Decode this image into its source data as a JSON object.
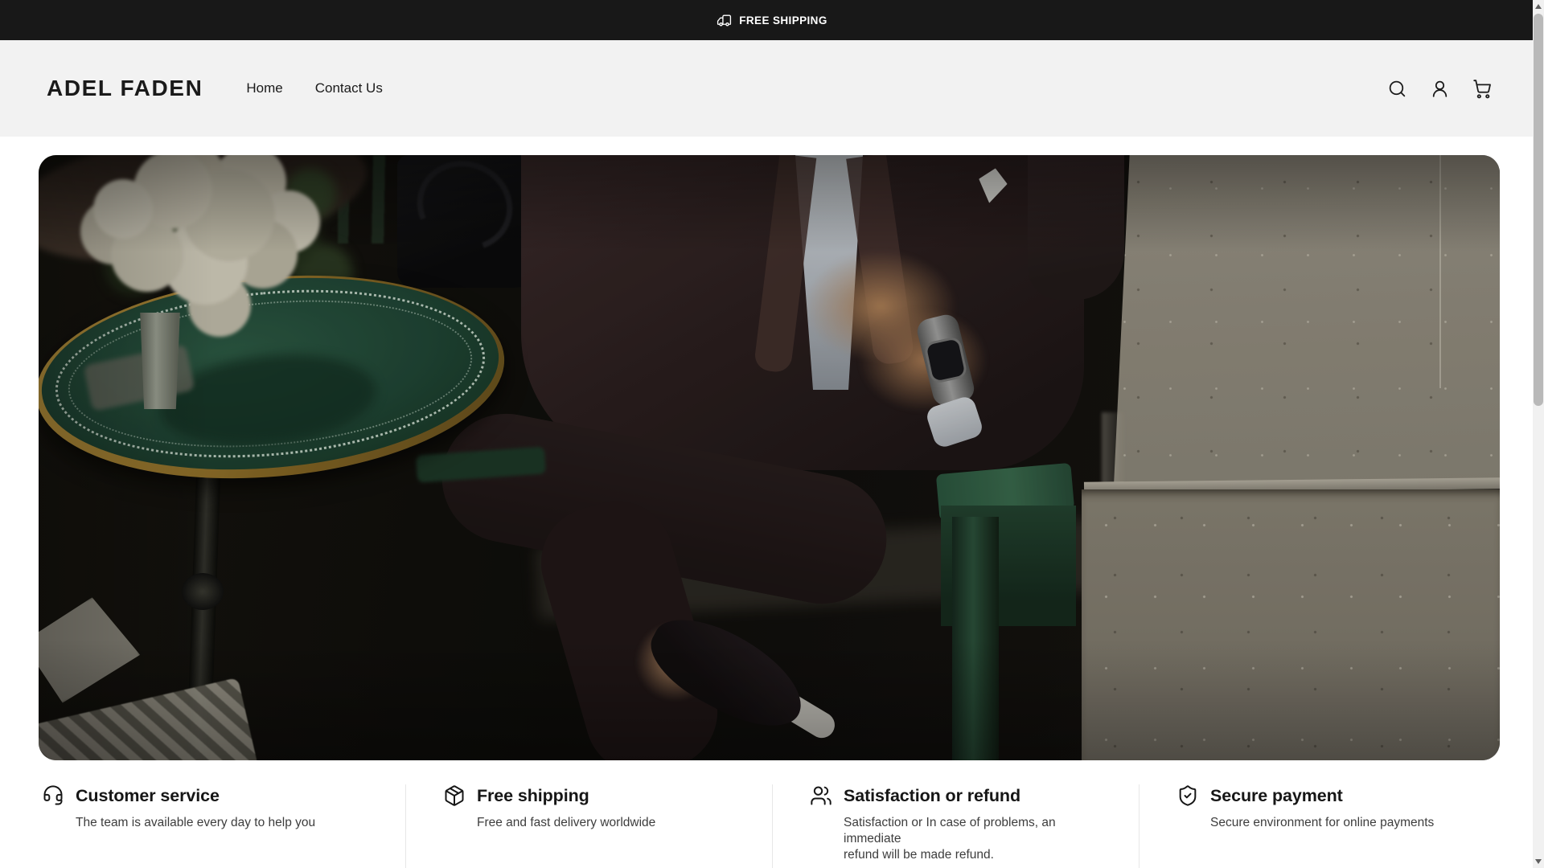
{
  "announcement": {
    "icon": "truck-icon",
    "text": "FREE SHIPPING"
  },
  "header": {
    "logo": "ADEL FADEN",
    "nav": [
      {
        "label": "Home"
      },
      {
        "label": "Contact Us"
      }
    ],
    "actions": [
      {
        "icon": "search-icon"
      },
      {
        "icon": "account-icon"
      },
      {
        "icon": "cart-icon"
      }
    ]
  },
  "hero": {
    "description": "Video still: man in a dark burgundy suit seated on a green bench beside a green bistro table with a bouquet of white flowers, black leather bag, and a limestone pillar on the right"
  },
  "features": [
    {
      "icon": "headset-icon",
      "title": "Customer service",
      "description": "The team is available every day to help you"
    },
    {
      "icon": "package-icon",
      "title": "Free shipping",
      "description": "Free and fast delivery worldwide"
    },
    {
      "icon": "users-icon",
      "title": "Satisfaction or refund",
      "description": "Satisfaction or In case of problems, an immediate\nrefund will be made refund."
    },
    {
      "icon": "shield-check-icon",
      "title": "Secure payment",
      "description": "Secure environment for online payments"
    }
  ],
  "colors": {
    "announcement_bg": "#181818",
    "announcement_fg": "#ffffff",
    "header_bg": "#f2f2f2",
    "page_bg": "#ffffff",
    "text": "#1a1a1a",
    "muted_text": "#3d3d3d",
    "divider": "#e7e7e7"
  }
}
